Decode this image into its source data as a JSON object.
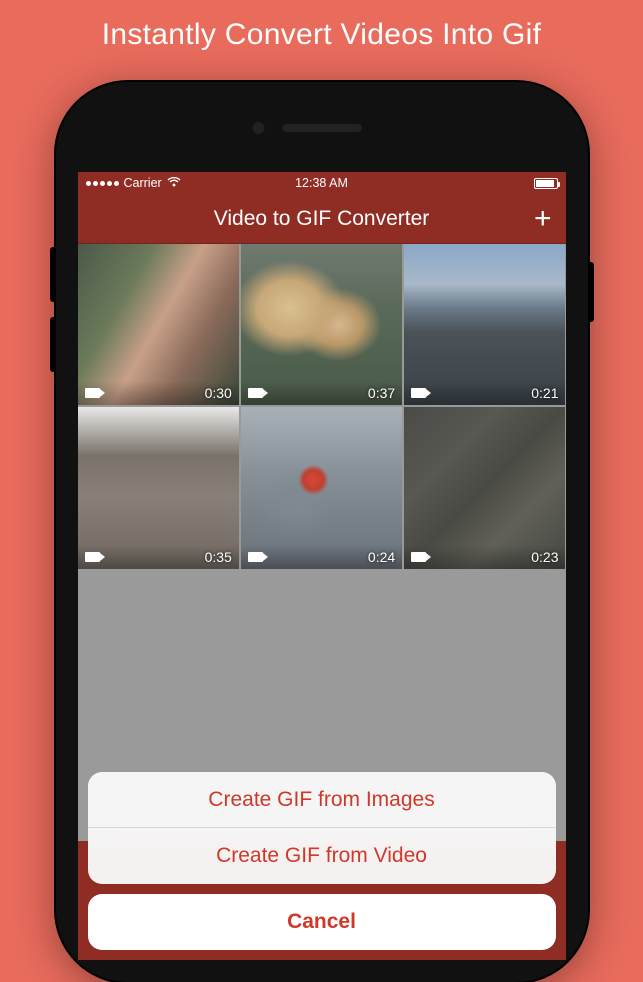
{
  "banner": {
    "title": "Instantly Convert Videos Into Gif"
  },
  "statusbar": {
    "carrier": "Carrier",
    "time": "12:38 AM"
  },
  "navbar": {
    "title": "Video to GIF Converter",
    "plus": "+"
  },
  "videos": [
    {
      "duration": "0:30"
    },
    {
      "duration": "0:37"
    },
    {
      "duration": "0:21"
    },
    {
      "duration": "0:35"
    },
    {
      "duration": "0:24"
    },
    {
      "duration": "0:23"
    }
  ],
  "sheet": {
    "option1": "Create GIF from Images",
    "option2": "Create GIF from Video",
    "cancel": "Cancel"
  },
  "colors": {
    "accent": "#8f2d24",
    "bg": "#e86b5c",
    "action": "#d0382a"
  }
}
